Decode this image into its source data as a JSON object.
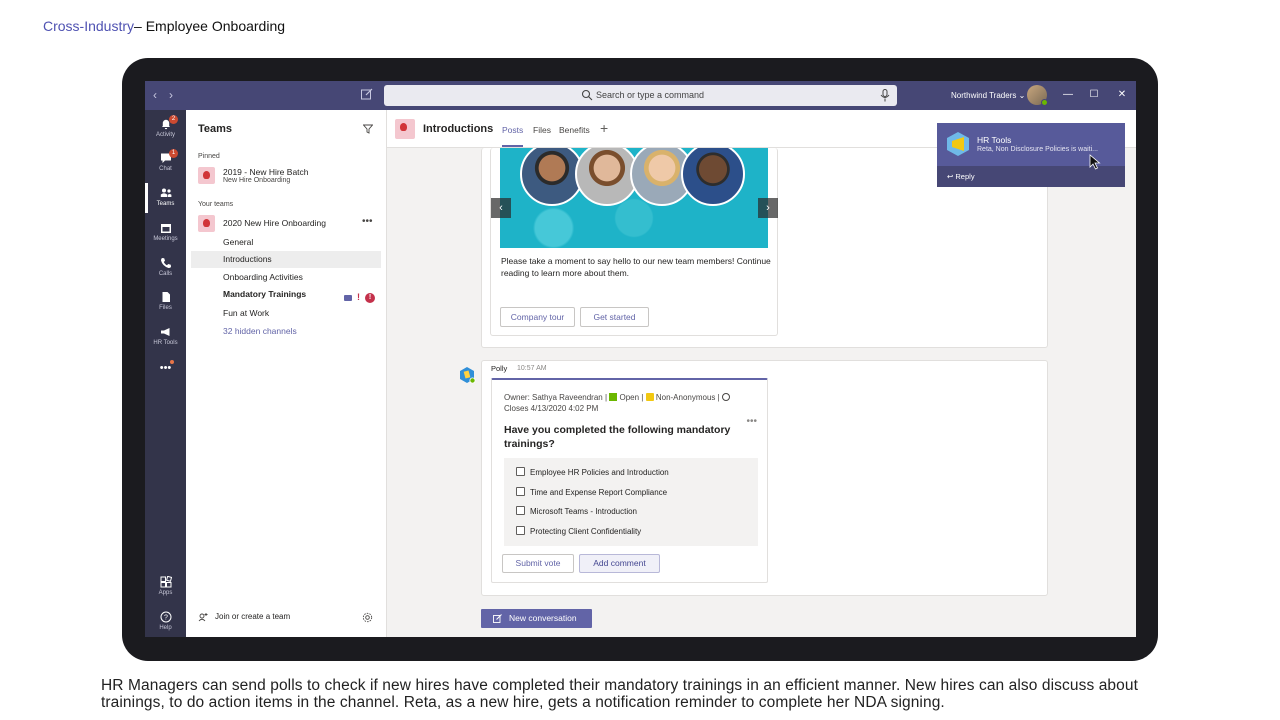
{
  "slide": {
    "title_link": "Cross-Industry",
    "title_rest": "– Employee Onboarding",
    "caption": "HR Managers can send polls to check if new hires have completed their mandatory trainings in an efficient manner. New hires can also discuss about trainings, to do action items in the channel. Reta, as a new hire, gets a notification reminder to complete her NDA signing."
  },
  "titlebar": {
    "search_placeholder": "Search or type a command",
    "org_name": "Northwind Traders",
    "org_chevron": "⌄",
    "back": "‹",
    "forward": "›",
    "min": "—",
    "max": "☐",
    "close": "✕"
  },
  "appbar": {
    "items": [
      {
        "label": "Activity",
        "icon": "bell-icon",
        "badge": "2"
      },
      {
        "label": "Chat",
        "icon": "chat-icon",
        "badge": "1"
      },
      {
        "label": "Teams",
        "icon": "teams-icon"
      },
      {
        "label": "Meetings",
        "icon": "calendar-icon"
      },
      {
        "label": "Calls",
        "icon": "phone-icon"
      },
      {
        "label": "Files",
        "icon": "file-icon"
      },
      {
        "label": "HR Tools",
        "icon": "megaphone-icon"
      },
      {
        "label": "Apps",
        "icon": "apps-icon"
      },
      {
        "label": "Help",
        "icon": "help-icon"
      }
    ],
    "more": "•••"
  },
  "teams_panel": {
    "title": "Teams",
    "pinned_label": "Pinned",
    "pinned_team": {
      "name": "2019 - New Hire Batch",
      "sub": "New Hire Onboarding"
    },
    "your_teams_label": "Your teams",
    "team": {
      "name": "2020 New Hire Onboarding",
      "more": "•••"
    },
    "channels": [
      "General",
      "Introductions",
      "Onboarding Activities",
      "Mandatory Trainings",
      "Fun at Work"
    ],
    "hidden_channels": "32 hidden channels",
    "mandatory_badge": "!",
    "join_label": "Join or create a team"
  },
  "channel_header": {
    "title": "Introductions",
    "tabs": [
      "Posts",
      "Files",
      "Benefits"
    ],
    "add": "+"
  },
  "intro_post": {
    "text": "Please take a moment to say hello to our new team members! Continue reading to learn more about them.",
    "prev": "‹",
    "next": "›",
    "buttons": [
      "Company tour",
      "Get started"
    ]
  },
  "poll": {
    "author": "Polly",
    "time": "10:57 AM",
    "owner_line_1": "Owner: Sathya Raveendran |",
    "status_open": "Open |",
    "anonymity": "Non-Anonymous |",
    "closes": "Closes 4/13/2020 4:02 PM",
    "more": "•••",
    "question": "Have you completed the following mandatory trainings?",
    "options": [
      "Employee HR Policies and Introduction",
      "Time and Expense Report Compliance",
      "Microsoft Teams - Introduction",
      "Protecting Client Confidentiality"
    ],
    "submit_label": "Submit vote",
    "comment_label": "Add comment"
  },
  "new_conversation_label": "New conversation",
  "toast": {
    "title": "HR Tools",
    "subtitle": "Reta, Non Disclosure Policies is waiti...",
    "reply": "Reply"
  }
}
